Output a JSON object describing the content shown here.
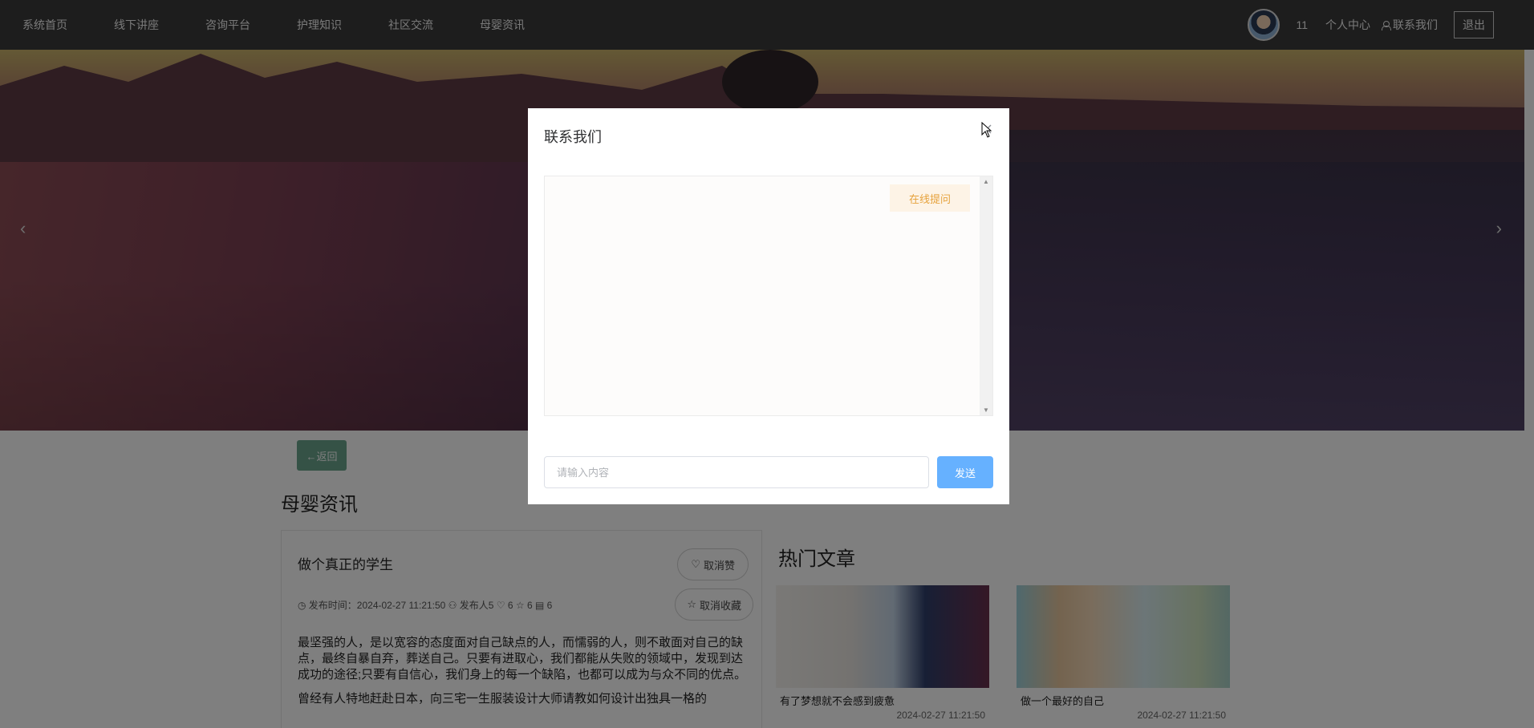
{
  "nav": {
    "items": [
      "系统首页",
      "线下讲座",
      "咨询平台",
      "护理知识",
      "社区交流",
      "母婴资讯"
    ],
    "user_name": "11",
    "personal_center": "个人中心",
    "contact_us": "联系我们",
    "logout": "退出"
  },
  "banner": {
    "prev_arrow": "‹",
    "next_arrow": "›"
  },
  "page": {
    "back_label": "←返回",
    "section_title": "母婴资讯",
    "article": {
      "title": "做个真正的学生",
      "like_label": "取消赞",
      "fav_label": "取消收藏",
      "meta": "◷ 发布时间：2024-02-27 11:21:50 ⚇ 发布人5 ♡ 6 ☆ 6 ▤ 6",
      "body": [
        "最坚强的人，是以宽容的态度面对自己缺点的人，而懦弱的人，则不敢面对自己的缺点，最终自暴自弃，葬送自己。只要有进取心，我们都能从失败的领域中，发现到达成功的途径;只要有自信心，我们身上的每一个缺陷，也都可以成为与众不同的优点。",
        "曾经有人特地赶赴日本，向三宅一生服装设计大师请教如何设计出独具一格的"
      ]
    },
    "hot_title": "热门文章",
    "hot_articles": [
      {
        "caption": "有了梦想就不会感到疲惫",
        "date": "2024-02-27 11:21:50"
      },
      {
        "caption": "做一个最好的自己",
        "date": "2024-02-27 11:21:50"
      }
    ]
  },
  "modal": {
    "title": "联系我们",
    "online_ask": "在线提问",
    "input_placeholder": "请输入内容",
    "send_label": "发送"
  },
  "colors": {
    "nav_bg": "#3b3b3b",
    "back_btn": "#6aa58d",
    "send_btn": "#66b1ff",
    "ask_chip_text": "#e6a23c"
  }
}
